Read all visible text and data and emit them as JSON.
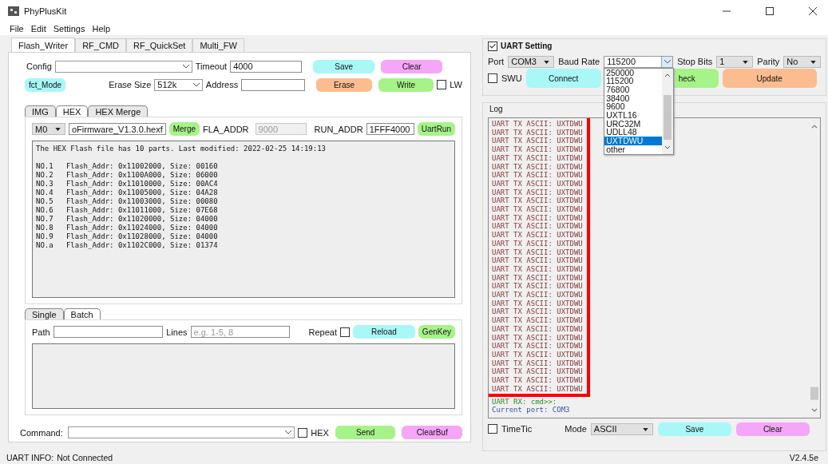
{
  "window": {
    "title": "PhyPlusKit"
  },
  "menu": [
    "File",
    "Edit",
    "Settings",
    "Help"
  ],
  "tabs": [
    {
      "label": "Flash_Writer",
      "selected": true
    },
    {
      "label": "RF_CMD",
      "selected": false
    },
    {
      "label": "RF_QuickSet",
      "selected": false
    },
    {
      "label": "Multi_FW",
      "selected": false
    }
  ],
  "flash_writer": {
    "config_label": "Config",
    "timeout_label": "Timeout",
    "timeout": "4000",
    "save": "Save",
    "clear": "Clear",
    "fct_mode": "fct_Mode",
    "erase_size_label": "Erase Size",
    "erase_size": "512k",
    "address_label": "Address",
    "erase": "Erase",
    "write": "Write",
    "lw": {
      "label": "LW",
      "checked": false
    }
  },
  "image_tabs": [
    {
      "label": "IMG",
      "selected": false
    },
    {
      "label": "HEX",
      "selected": true
    },
    {
      "label": "HEX Merge",
      "selected": false
    }
  ],
  "hex": {
    "module": "M0",
    "file": "oFirmware_V1.3.0.hexf",
    "merge": "Merge",
    "fla_addr_label": "FLA_ADDR",
    "fla_addr": "9000",
    "fla_addr_disabled": true,
    "run_addr_label": "RUN_ADDR",
    "run_addr": "1FFF4000",
    "uart_run": "UartRun",
    "info": "The HEX Flash file has 10 parts. Last modified: 2022-02-25 14:19:13",
    "parts": [
      "NO.1   Flash_Addr: 0x11002000, Size: 00160",
      "NO.2   Flash_Addr: 0x1100A000, Size: 06000",
      "NO.3   Flash_Addr: 0x11010000, Size: 00AC4",
      "NO.4   Flash_Addr: 0x11005000, Size: 04A28",
      "NO.5   Flash_Addr: 0x11003000, Size: 00080",
      "NO.6   Flash_Addr: 0x11011000, Size: 07E68",
      "NO.7   Flash_Addr: 0x11020000, Size: 04000",
      "NO.8   Flash_Addr: 0x11024000, Size: 04000",
      "NO.9   Flash_Addr: 0x11028000, Size: 04000",
      "NO.a   Flash_Addr: 0x1102C000, Size: 01374"
    ]
  },
  "mode_tabs": [
    {
      "label": "Single",
      "selected": false
    },
    {
      "label": "Batch",
      "selected": true
    }
  ],
  "batch": {
    "path_label": "Path",
    "lines_label": "Lines",
    "lines_placeholder": "e.g. 1-5, 8",
    "repeat": {
      "label": "Repeat",
      "checked": false
    },
    "reload": "Reload",
    "genkey": "GenKey"
  },
  "command": {
    "label": "Command:",
    "hex": {
      "label": "HEX",
      "checked": false
    },
    "send": "Send",
    "clear_buf": "ClearBuf"
  },
  "uart_setting": {
    "title": "UART Setting",
    "checked": true,
    "port_label": "Port",
    "port": "COM3",
    "baud_label": "Baud Rate",
    "baud": "115200",
    "stop_bits_label": "Stop Bits",
    "stop_bits": "1",
    "parity_label": "Parity",
    "parity": "No",
    "baud_options": [
      {
        "label": "250000",
        "selected": false
      },
      {
        "label": "115200",
        "selected": false
      },
      {
        "label": "76800",
        "selected": false
      },
      {
        "label": "38400",
        "selected": false
      },
      {
        "label": "9600",
        "selected": false
      },
      {
        "label": "UXTL16",
        "selected": false
      },
      {
        "label": "URC32M",
        "selected": false
      },
      {
        "label": "UDLL48",
        "selected": false
      },
      {
        "label": "UXTDWU",
        "selected": true
      },
      {
        "label": "other",
        "selected": false
      }
    ],
    "swu": {
      "label": "SWU",
      "checked": false
    },
    "connect": "Connect",
    "check": "heck",
    "update": "Update"
  },
  "log": {
    "title": "Log",
    "lines": [
      {
        "kind": "tx",
        "text": "UART TX ASCII: UXTDWU"
      },
      {
        "kind": "tx",
        "text": "UART TX ASCII: UXTDWU"
      },
      {
        "kind": "tx",
        "text": "UART TX ASCII: UXTDWU"
      },
      {
        "kind": "tx",
        "text": "UART TX ASCII: UXTDWU"
      },
      {
        "kind": "tx",
        "text": "UART TX ASCII: UXTDWU"
      },
      {
        "kind": "tx",
        "text": "UART TX ASCII: UXTDWU"
      },
      {
        "kind": "tx",
        "text": "UART TX ASCII: UXTDWU"
      },
      {
        "kind": "tx",
        "text": "UART TX ASCII: UXTDWU"
      },
      {
        "kind": "tx",
        "text": "UART TX ASCII: UXTDWU"
      },
      {
        "kind": "tx",
        "text": "UART TX ASCII: UXTDWU"
      },
      {
        "kind": "tx",
        "text": "UART TX ASCII: UXTDWU"
      },
      {
        "kind": "tx",
        "text": "UART TX ASCII: UXTDWU"
      },
      {
        "kind": "tx",
        "text": "UART TX ASCII: UXTDWU"
      },
      {
        "kind": "tx",
        "text": "UART TX ASCII: UXTDWU"
      },
      {
        "kind": "tx",
        "text": "UART TX ASCII: UXTDWU"
      },
      {
        "kind": "tx",
        "text": "UART TX ASCII: UXTDWU"
      },
      {
        "kind": "tx",
        "text": "UART TX ASCII: UXTDWU"
      },
      {
        "kind": "tx",
        "text": "UART TX ASCII: UXTDWU"
      },
      {
        "kind": "tx",
        "text": "UART TX ASCII: UXTDWU"
      },
      {
        "kind": "tx",
        "text": "UART TX ASCII: UXTDWU"
      },
      {
        "kind": "tx",
        "text": "UART TX ASCII: UXTDWU"
      },
      {
        "kind": "tx",
        "text": "UART TX ASCII: UXTDWU"
      },
      {
        "kind": "tx",
        "text": "UART TX ASCII: UXTDWU"
      },
      {
        "kind": "tx",
        "text": "UART TX ASCII: UXTDWU"
      },
      {
        "kind": "tx",
        "text": "UART TX ASCII: UXTDWU"
      },
      {
        "kind": "tx",
        "text": "UART TX ASCII: UXTDWU"
      },
      {
        "kind": "tx",
        "text": "UART TX ASCII: UXTDWU"
      },
      {
        "kind": "tx",
        "text": "UART TX ASCII: UXTDWU"
      },
      {
        "kind": "tx",
        "text": "UART TX ASCII: UXTDWU"
      },
      {
        "kind": "tx",
        "text": "UART TX ASCII: UXTDWU"
      },
      {
        "kind": "tx",
        "text": "UART TX ASCII: UXTDWU"
      },
      {
        "kind": "tx",
        "text": "UART TX ASCII: UXTDWU"
      },
      {
        "kind": "rx",
        "text": "UART RX: cmd>>:"
      },
      {
        "kind": "info",
        "text": "Current port: COM3"
      }
    ],
    "timetic": {
      "label": "TimeTic",
      "checked": false
    },
    "mode_label": "Mode",
    "mode": "ASCII",
    "save": "Save",
    "clear": "Clear"
  },
  "status_bar": {
    "label": "UART INFO:",
    "value": "Not Connected",
    "version": "V2.4.5e"
  }
}
